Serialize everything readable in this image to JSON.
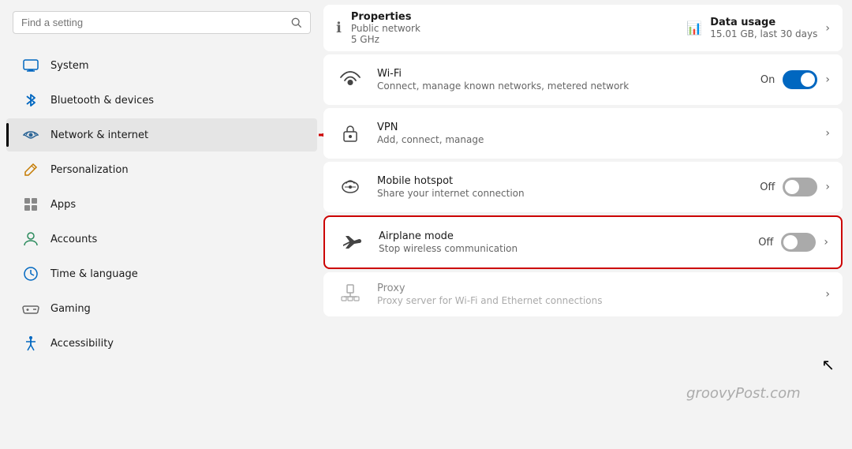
{
  "sidebar": {
    "search": {
      "placeholder": "Find a setting",
      "value": ""
    },
    "items": [
      {
        "id": "system",
        "label": "System",
        "icon": "monitor"
      },
      {
        "id": "bluetooth",
        "label": "Bluetooth & devices",
        "icon": "bluetooth"
      },
      {
        "id": "network",
        "label": "Network & internet",
        "icon": "network",
        "active": true
      },
      {
        "id": "personalization",
        "label": "Personalization",
        "icon": "pencil"
      },
      {
        "id": "apps",
        "label": "Apps",
        "icon": "apps"
      },
      {
        "id": "accounts",
        "label": "Accounts",
        "icon": "person"
      },
      {
        "id": "time",
        "label": "Time & language",
        "icon": "clock"
      },
      {
        "id": "gaming",
        "label": "Gaming",
        "icon": "controller"
      },
      {
        "id": "accessibility",
        "label": "Accessibility",
        "icon": "accessibility"
      }
    ]
  },
  "main": {
    "top_card": {
      "left_title": "Properties",
      "left_subtitle1": "Public network",
      "left_subtitle2": "5 GHz",
      "right_title": "Data usage",
      "right_subtitle": "15.01 GB, last 30 days"
    },
    "settings": [
      {
        "id": "wifi",
        "title": "Wi-Fi",
        "desc": "Connect, manage known networks, metered network",
        "status": "On",
        "toggle": "on",
        "highlighted": false
      },
      {
        "id": "vpn",
        "title": "VPN",
        "desc": "Add, connect, manage",
        "status": "",
        "toggle": null,
        "highlighted": false
      },
      {
        "id": "hotspot",
        "title": "Mobile hotspot",
        "desc": "Share your internet connection",
        "status": "Off",
        "toggle": "off",
        "highlighted": false
      },
      {
        "id": "airplane",
        "title": "Airplane mode",
        "desc": "Stop wireless communication",
        "status": "Off",
        "toggle": "off",
        "highlighted": true
      }
    ],
    "proxy": {
      "title": "Proxy",
      "desc": "Proxy server for Wi-Fi and Ethernet connections"
    },
    "watermark": "groovyPost.com"
  }
}
